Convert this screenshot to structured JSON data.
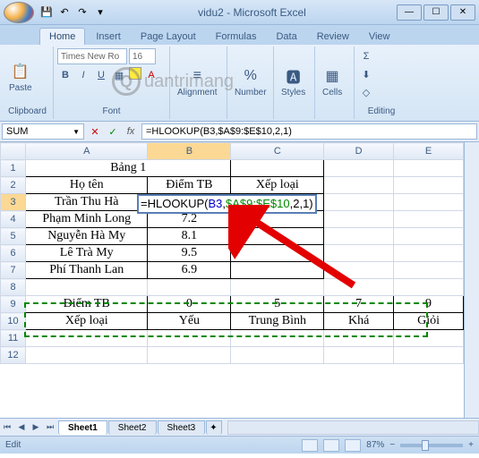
{
  "window": {
    "title": "vidu2 - Microsoft Excel"
  },
  "qat": {
    "save": "💾",
    "undo": "↶",
    "redo": "↷",
    "drop": "▾"
  },
  "tabs": [
    "Home",
    "Insert",
    "Page Layout",
    "Formulas",
    "Data",
    "Review",
    "View"
  ],
  "ribbon": {
    "clipboard": {
      "label": "Clipboard",
      "paste": "Paste"
    },
    "font": {
      "label": "Font",
      "name": "Times New Ro",
      "size": "16",
      "bold": "B",
      "italic": "I",
      "underline": "U"
    },
    "alignment": {
      "label": "Alignment"
    },
    "number": {
      "label": "Number",
      "btn": "%"
    },
    "styles": {
      "label": "Styles"
    },
    "cells": {
      "label": "Cells"
    },
    "editing": {
      "label": "Editing",
      "sigma": "Σ"
    }
  },
  "namebox": "SUM",
  "formula_bar": "=HLOOKUP(B3,$A$9:$E$10,2,1)",
  "columns": [
    "A",
    "B",
    "C",
    "D",
    "E"
  ],
  "rows": [
    "1",
    "2",
    "3",
    "4",
    "5",
    "6",
    "7",
    "8",
    "9",
    "10",
    "11",
    "12"
  ],
  "cells": {
    "A1B1": "Bảng 1",
    "A2": "Họ tên",
    "B2": "Điểm TB",
    "C2": "Xếp loại",
    "A3": "Trần Thu Hà",
    "A4": "Phạm Minh Long",
    "B4": "7.2",
    "A5": "Nguyễn Hà My",
    "B5": "8.1",
    "A6": "Lê Trà My",
    "B6": "9.5",
    "A7": "Phí Thanh Lan",
    "B7": "6.9",
    "A9": "Điểm TB",
    "B9": "0",
    "C9": "5",
    "D9": "7",
    "E9": "9",
    "A10": "Xếp loại",
    "B10": "Yếu",
    "C10": "Trung Bình",
    "D10": "Khá",
    "E10": "Giỏi"
  },
  "active_formula": {
    "prefix": "=HLOOKUP(",
    "ref1": "B3",
    "mid": ",",
    "ref2": "$A$9:$E$10",
    "suffix": ",2,1)"
  },
  "sheets": [
    "Sheet1",
    "Sheet2",
    "Sheet3"
  ],
  "status": {
    "mode": "Edit",
    "zoom": "87%"
  },
  "watermark": {
    "text": "uantrimang",
    "letter": "Q"
  },
  "win": {
    "min": "—",
    "max": "☐",
    "close": "✕"
  }
}
